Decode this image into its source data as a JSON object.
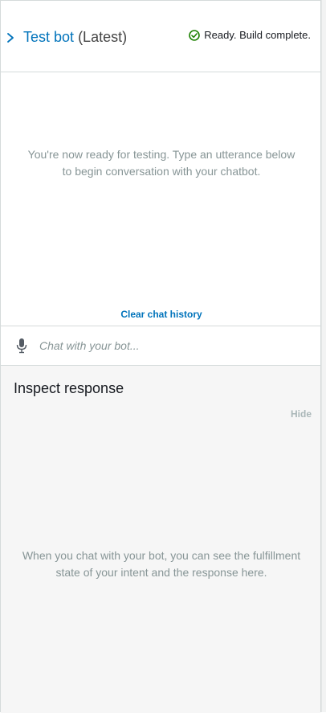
{
  "header": {
    "bot_name": "Test bot",
    "version": "(Latest)",
    "status_text": "Ready. Build complete."
  },
  "conversation": {
    "ready_message": "You're now ready for testing. Type an utterance below to begin conversation with your chatbot.",
    "clear_history_label": "Clear chat history"
  },
  "input": {
    "placeholder": "Chat with your bot...",
    "value": ""
  },
  "inspect": {
    "title": "Inspect response",
    "hide_label": "Hide",
    "empty_message": "When you chat with your bot, you can see the fulfillment state of your intent and the response here."
  },
  "icons": {
    "expand": "chevron-right-icon",
    "status": "check-circle-icon",
    "voice": "microphone-icon"
  },
  "colors": {
    "link": "#0073bb",
    "success": "#1d8102",
    "muted_text": "#879596",
    "inspect_background": "#f6f6f6"
  }
}
